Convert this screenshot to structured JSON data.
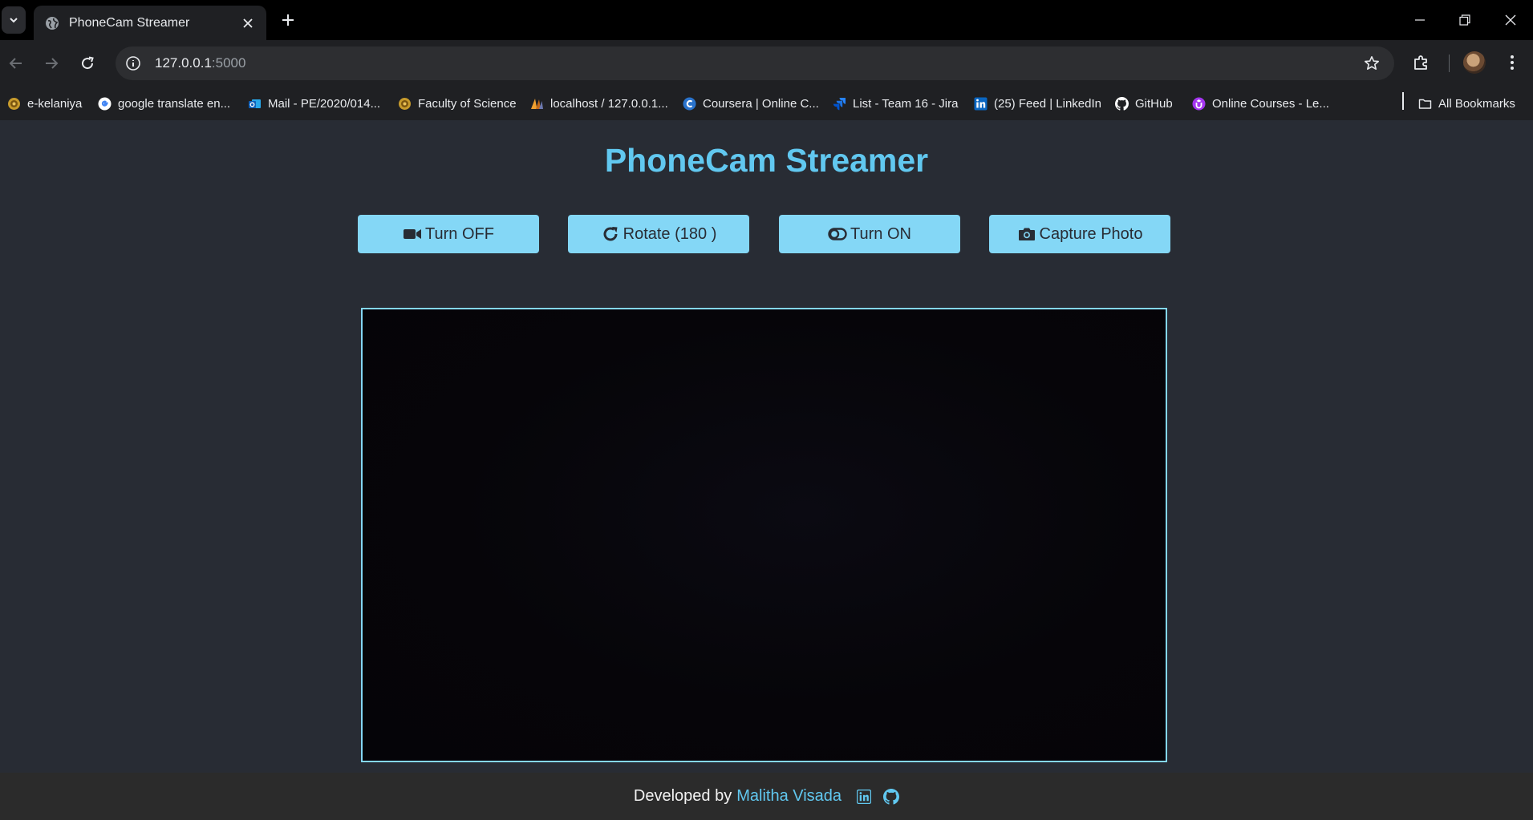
{
  "browser": {
    "tab": {
      "title": "PhoneCam Streamer",
      "favicon": "globe-icon"
    },
    "address": {
      "host": "127.0.0.1",
      "port": ":5000"
    },
    "bookmarks": [
      {
        "label": "e-kelaniya",
        "icon": "university-seal-icon",
        "color": "#c79b2c"
      },
      {
        "label": "google translate en...",
        "icon": "google-icon",
        "color": "#ffffff"
      },
      {
        "label": "Mail - PE/2020/014...",
        "icon": "outlook-icon",
        "color": "#1f77d4"
      },
      {
        "label": "Faculty of Science",
        "icon": "university-seal-icon",
        "color": "#c79b2c"
      },
      {
        "label": "localhost / 127.0.0.1...",
        "icon": "phpmyadmin-icon",
        "color": "#f0a030"
      },
      {
        "label": "Coursera | Online C...",
        "icon": "coursera-icon",
        "color": "#2a73cc"
      },
      {
        "label": "List - Team 16 - Jira",
        "icon": "jira-icon",
        "color": "#2684ff"
      },
      {
        "label": "(25) Feed | LinkedIn",
        "icon": "linkedin-icon",
        "color": "#0a66c2"
      },
      {
        "label": "GitHub",
        "icon": "github-icon",
        "color": "#ffffff"
      },
      {
        "label": "Online Courses - Le...",
        "icon": "udemy-icon",
        "color": "#a435f0"
      }
    ],
    "all_bookmarks": "All Bookmarks"
  },
  "page": {
    "title": "PhoneCam Streamer",
    "buttons": [
      {
        "label": "Turn OFF",
        "icon": "video-camera-icon"
      },
      {
        "label": "Rotate (180 )",
        "icon": "rotate-icon"
      },
      {
        "label": "Turn ON",
        "icon": "toggle-icon"
      },
      {
        "label": "Capture Photo",
        "icon": "camera-icon"
      }
    ],
    "footer": {
      "prefix": "Developed by",
      "name": "Malitha Visada",
      "icons": [
        "linkedin-icon",
        "github-icon"
      ]
    },
    "colors": {
      "background": "#282c34",
      "accent": "#61c8f0",
      "button": "#84d7f6",
      "footer": "#2b2b2b"
    }
  }
}
